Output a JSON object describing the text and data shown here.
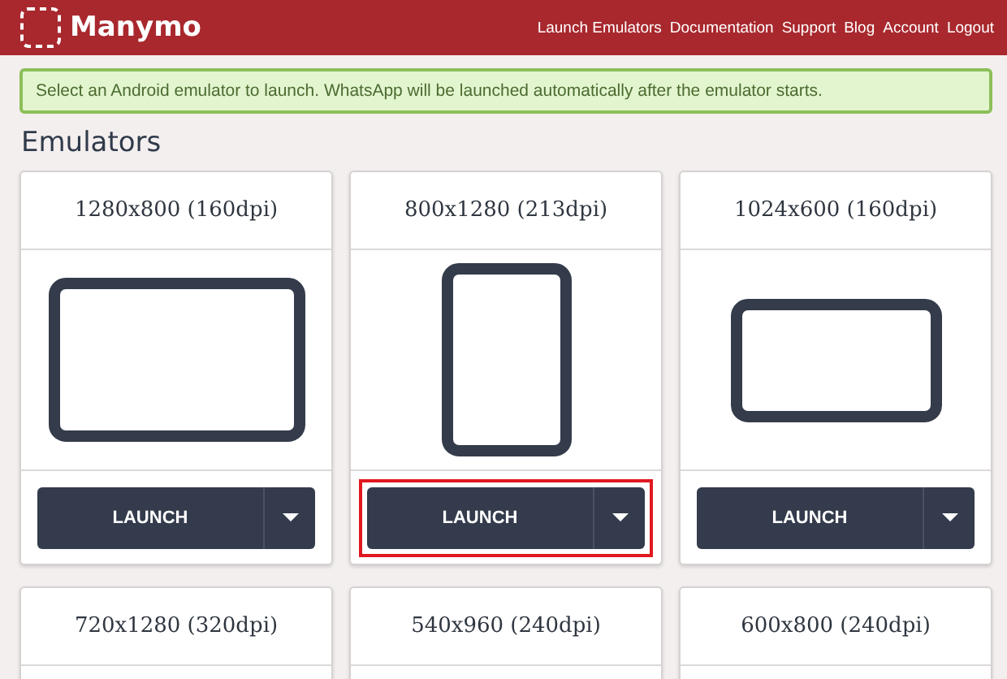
{
  "header": {
    "logo": "Manymo",
    "nav": [
      "Launch Emulators",
      "Documentation",
      "Support",
      "Blog",
      "Account",
      "Logout"
    ]
  },
  "notice": "Select an Android emulator to launch. WhatsApp will be launched automatically after the emulator starts.",
  "section_title": "Emulators",
  "emulators": [
    {
      "title": "1280x800 (160dpi)",
      "kind": "landscape",
      "button": "LAUNCH",
      "highlighted": false
    },
    {
      "title": "800x1280 (213dpi)",
      "kind": "portrait",
      "button": "LAUNCH",
      "highlighted": true
    },
    {
      "title": "1024x600 (160dpi)",
      "kind": "wide",
      "button": "LAUNCH",
      "highlighted": false
    },
    {
      "title": "720x1280 (320dpi)"
    },
    {
      "title": "540x960 (240dpi)"
    },
    {
      "title": "600x800 (240dpi)"
    }
  ]
}
